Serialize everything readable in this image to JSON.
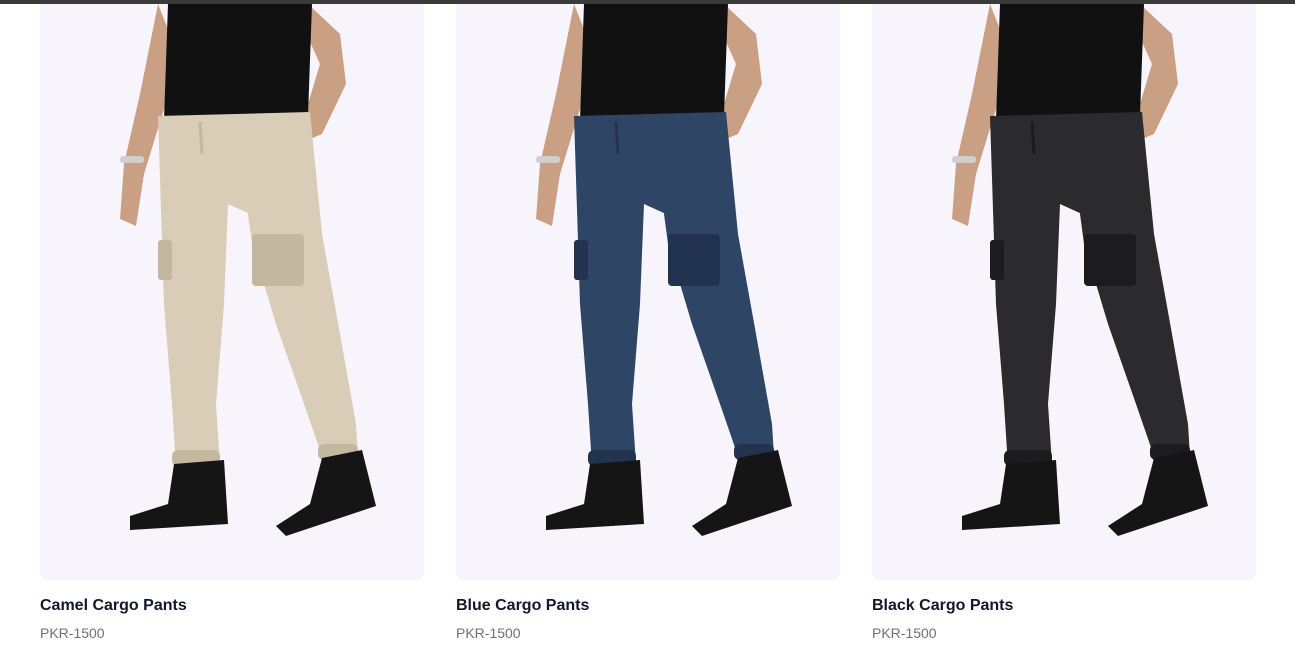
{
  "products": [
    {
      "name": "Camel Cargo Pants",
      "price": "PKR-1500",
      "pant_color": "#d9cdb7",
      "pant_shade": "#c4b79f"
    },
    {
      "name": "Blue Cargo Pants",
      "price": "PKR-1500",
      "pant_color": "#2f4566",
      "pant_shade": "#223350"
    },
    {
      "name": "Black Cargo Pants",
      "price": "PKR-1500",
      "pant_color": "#2b2b2d",
      "pant_shade": "#1c1c1e"
    }
  ],
  "colors": {
    "image_background": "#f8f4fc",
    "shirt": "#111111",
    "skin": "#c9a083",
    "boot": "#151515",
    "title_text": "#111827",
    "price_text": "#6b7280"
  }
}
